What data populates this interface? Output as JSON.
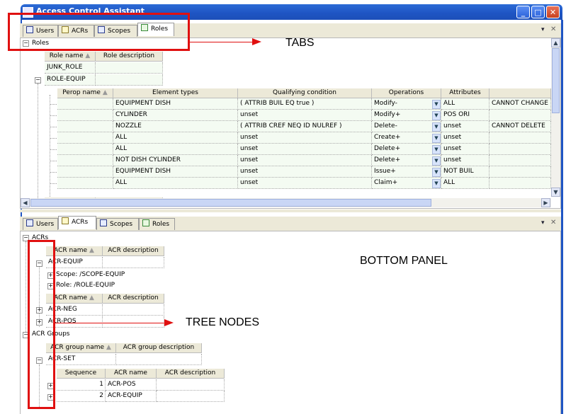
{
  "window": {
    "title": "Access Control Assistant"
  },
  "top_panel": {
    "tabs": [
      "Users",
      "ACRs",
      "Scopes",
      "Roles"
    ],
    "section_label": "Roles",
    "role_columns": [
      "Role name",
      "Role description"
    ],
    "roles": [
      "JUNK_ROLE",
      "ROLE-EQUIP"
    ],
    "perop_columns": [
      "Perop name",
      "Element types",
      "Qualifying condition",
      "Operations",
      "Attributes"
    ],
    "perop_rows": [
      {
        "element": "EQUIPMENT DISH",
        "condition": "( ATTRIB BUIL EQ true )",
        "operation": "Modify-",
        "attributes": "ALL",
        "message": "CANNOT CHANGE"
      },
      {
        "element": "CYLINDER",
        "condition": "unset",
        "operation": "Modify+",
        "attributes": "POS ORI",
        "message": ""
      },
      {
        "element": "NOZZLE",
        "condition": "( ATTRIB CREF NEQ ID NULREF )",
        "operation": "Delete-",
        "attributes": "unset",
        "message": "CANNOT DELETE"
      },
      {
        "element": "ALL",
        "condition": "unset",
        "operation": "Create+",
        "attributes": "unset",
        "message": ""
      },
      {
        "element": "ALL",
        "condition": "unset",
        "operation": "Delete+",
        "attributes": "unset",
        "message": ""
      },
      {
        "element": "NOT DISH CYLINDER",
        "condition": "unset",
        "operation": "Delete+",
        "attributes": "unset",
        "message": ""
      },
      {
        "element": "EQUIPMENT DISH",
        "condition": "unset",
        "operation": "Issue+",
        "attributes": "NOT BUIL",
        "message": ""
      },
      {
        "element": "ALL",
        "condition": "unset",
        "operation": "Claim+",
        "attributes": "ALL",
        "message": ""
      }
    ]
  },
  "bottom_panel": {
    "tabs": [
      "Users",
      "ACRs",
      "Scopes",
      "Roles"
    ],
    "acrs_label": "ACRs",
    "acr_columns": [
      "ACR name",
      "ACR description"
    ],
    "acr_equip": "ACR-EQUIP",
    "scope_node": "Scope: /SCOPE-EQUIP",
    "role_node": "Role: /ROLE-EQUIP",
    "acr_neg": "ACR-NEG",
    "acr_pos": "ACR-POS",
    "acr_groups_label": "ACR Groups",
    "group_columns": [
      "ACR group name",
      "ACR group description"
    ],
    "acr_set": "ACR-SET",
    "seq_columns": [
      "Sequence",
      "ACR name",
      "ACR description"
    ],
    "seq_rows": [
      {
        "sequence": "1",
        "name": "ACR-POS"
      },
      {
        "sequence": "2",
        "name": "ACR-EQUIP"
      }
    ]
  },
  "annotations": {
    "tabs": "TABS",
    "bottom_panel": "BOTTOM PANEL",
    "tree_nodes": "TREE NODES"
  }
}
